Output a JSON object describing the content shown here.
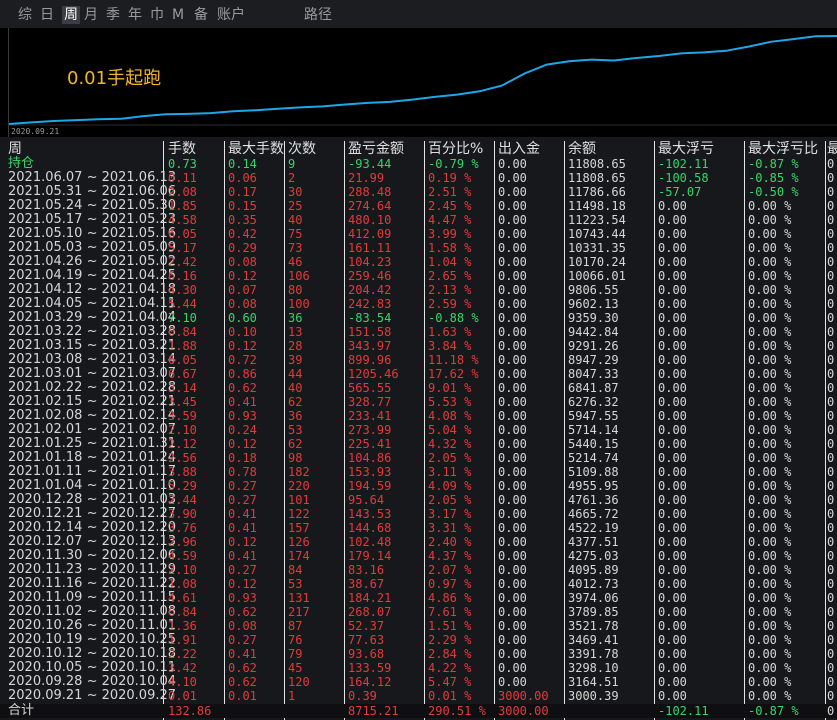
{
  "tabs": [
    {
      "label": "综",
      "state": "normal"
    },
    {
      "label": "日",
      "state": "normal"
    },
    {
      "label": "周",
      "state": "active"
    },
    {
      "label": "月",
      "state": "normal"
    },
    {
      "label": "季",
      "state": "normal"
    },
    {
      "label": "年",
      "state": "normal"
    },
    {
      "label": "巾",
      "state": "normal"
    },
    {
      "label": "M",
      "state": "normal"
    },
    {
      "label": "备",
      "state": "normal"
    },
    {
      "label": "账户",
      "state": "normal"
    },
    {
      "label": "路径",
      "state": "normal"
    }
  ],
  "chart": {
    "label": "0.01手起跑",
    "start_date": "2020.09.21",
    "line_color": "#1ea7e8",
    "label_color": "#f0b52a",
    "values": [
      3000.39,
      3164.51,
      3298.1,
      3391.78,
      3469.41,
      3521.78,
      3789.85,
      3974.06,
      4012.73,
      4095.89,
      4275.03,
      4377.51,
      4522.19,
      4665.72,
      4761.36,
      4955.95,
      5109.88,
      5214.74,
      5440.15,
      5714.14,
      5947.55,
      6276.32,
      6841.87,
      8047.33,
      8947.29,
      9291.26,
      9442.84,
      9359.3,
      9602.13,
      9806.55,
      10066.01,
      10170.24,
      10331.35,
      10743.44,
      11223.54,
      11498.18,
      11786.66,
      11808.65
    ]
  },
  "table": {
    "headers": [
      "周",
      "手数",
      "最大手数",
      "次数",
      "盈亏金额",
      "百分比%",
      "出入金",
      "余额",
      "最大浮亏",
      "最大浮亏比",
      "最"
    ],
    "holding": {
      "period": "持仓",
      "lots": "0.73",
      "max_lots": "0.14",
      "count": "9",
      "pnl": "-93.44",
      "pct": "-0.79 %",
      "io": "0.00",
      "balance": "11808.65",
      "max_float_loss": "-102.11",
      "max_float_loss_pct": "-0.87 %",
      "last": "0",
      "color": "green"
    },
    "rows": [
      {
        "period": "2021.06.07 ~ 2021.06.13",
        "lots": "0.11",
        "max_lots": "0.06",
        "count": "2",
        "pnl": "21.99",
        "pct": "0.19 %",
        "io": "0.00",
        "balance": "11808.65",
        "max_float_loss": "-100.58",
        "max_float_loss_pct": "-0.85 %",
        "last": "0",
        "color": "red",
        "float_color": "green"
      },
      {
        "period": "2021.05.31 ~ 2021.06.06",
        "lots": "2.08",
        "max_lots": "0.17",
        "count": "30",
        "pnl": "288.48",
        "pct": "2.51 %",
        "io": "0.00",
        "balance": "11786.66",
        "max_float_loss": "-57.07",
        "max_float_loss_pct": "-0.50 %",
        "last": "0",
        "color": "red",
        "float_color": "green"
      },
      {
        "period": "2021.05.24 ~ 2021.05.30",
        "lots": "1.85",
        "max_lots": "0.15",
        "count": "25",
        "pnl": "274.64",
        "pct": "2.45 %",
        "io": "0.00",
        "balance": "11498.18",
        "max_float_loss": "0.00",
        "max_float_loss_pct": "0.00 %",
        "last": "0",
        "color": "red",
        "float_color": "normal"
      },
      {
        "period": "2021.05.17 ~ 2021.05.23",
        "lots": "4.58",
        "max_lots": "0.35",
        "count": "40",
        "pnl": "480.10",
        "pct": "4.47 %",
        "io": "0.00",
        "balance": "11223.54",
        "max_float_loss": "0.00",
        "max_float_loss_pct": "0.00 %",
        "last": "0",
        "color": "red",
        "float_color": "normal"
      },
      {
        "period": "2021.05.10 ~ 2021.05.16",
        "lots": "6.05",
        "max_lots": "0.42",
        "count": "75",
        "pnl": "412.09",
        "pct": "3.99 %",
        "io": "0.00",
        "balance": "10743.44",
        "max_float_loss": "0.00",
        "max_float_loss_pct": "0.00 %",
        "last": "0",
        "color": "red",
        "float_color": "normal"
      },
      {
        "period": "2021.05.03 ~ 2021.05.09",
        "lots": "5.17",
        "max_lots": "0.29",
        "count": "73",
        "pnl": "161.11",
        "pct": "1.58 %",
        "io": "0.00",
        "balance": "10331.35",
        "max_float_loss": "0.00",
        "max_float_loss_pct": "0.00 %",
        "last": "0",
        "color": "red",
        "float_color": "normal"
      },
      {
        "period": "2021.04.26 ~ 2021.05.02",
        "lots": "2.42",
        "max_lots": "0.08",
        "count": "46",
        "pnl": "104.23",
        "pct": "1.04 %",
        "io": "0.00",
        "balance": "10170.24",
        "max_float_loss": "0.00",
        "max_float_loss_pct": "0.00 %",
        "last": "0",
        "color": "red",
        "float_color": "normal"
      },
      {
        "period": "2021.04.19 ~ 2021.04.25",
        "lots": "6.16",
        "max_lots": "0.12",
        "count": "106",
        "pnl": "259.46",
        "pct": "2.65 %",
        "io": "0.00",
        "balance": "10066.01",
        "max_float_loss": "0.00",
        "max_float_loss_pct": "0.00 %",
        "last": "0",
        "color": "red",
        "float_color": "normal"
      },
      {
        "period": "2021.04.12 ~ 2021.04.18",
        "lots": "4.30",
        "max_lots": "0.07",
        "count": "80",
        "pnl": "204.42",
        "pct": "2.13 %",
        "io": "0.00",
        "balance": "9806.55",
        "max_float_loss": "0.00",
        "max_float_loss_pct": "0.00 %",
        "last": "0",
        "color": "red",
        "float_color": "normal"
      },
      {
        "period": "2021.04.05 ~ 2021.04.11",
        "lots": "5.44",
        "max_lots": "0.08",
        "count": "100",
        "pnl": "242.83",
        "pct": "2.59 %",
        "io": "0.00",
        "balance": "9602.13",
        "max_float_loss": "0.00",
        "max_float_loss_pct": "0.00 %",
        "last": "0",
        "color": "red",
        "float_color": "normal"
      },
      {
        "period": "2021.03.29 ~ 2021.04.04",
        "lots": "7.10",
        "max_lots": "0.60",
        "count": "36",
        "pnl": "-83.54",
        "pct": "-0.88 %",
        "io": "0.00",
        "balance": "9359.30",
        "max_float_loss": "0.00",
        "max_float_loss_pct": "0.00 %",
        "last": "0",
        "color": "green",
        "float_color": "normal"
      },
      {
        "period": "2021.03.22 ~ 2021.03.28",
        "lots": "0.84",
        "max_lots": "0.10",
        "count": "13",
        "pnl": "151.58",
        "pct": "1.63 %",
        "io": "0.00",
        "balance": "9442.84",
        "max_float_loss": "0.00",
        "max_float_loss_pct": "0.00 %",
        "last": "0",
        "color": "red",
        "float_color": "normal"
      },
      {
        "period": "2021.03.15 ~ 2021.03.21",
        "lots": "1.88",
        "max_lots": "0.12",
        "count": "28",
        "pnl": "343.97",
        "pct": "3.84 %",
        "io": "0.00",
        "balance": "9291.26",
        "max_float_loss": "0.00",
        "max_float_loss_pct": "0.00 %",
        "last": "0",
        "color": "red",
        "float_color": "normal"
      },
      {
        "period": "2021.03.08 ~ 2021.03.14",
        "lots": "6.05",
        "max_lots": "0.72",
        "count": "39",
        "pnl": "899.96",
        "pct": "11.18 %",
        "io": "0.00",
        "balance": "8947.29",
        "max_float_loss": "0.00",
        "max_float_loss_pct": "0.00 %",
        "last": "0",
        "color": "red",
        "float_color": "normal"
      },
      {
        "period": "2021.03.01 ~ 2021.03.07",
        "lots": "6.67",
        "max_lots": "0.86",
        "count": "44",
        "pnl": "1205.46",
        "pct": "17.62 %",
        "io": "0.00",
        "balance": "8047.33",
        "max_float_loss": "0.00",
        "max_float_loss_pct": "0.00 %",
        "last": "0",
        "color": "red",
        "float_color": "normal"
      },
      {
        "period": "2021.02.22 ~ 2021.02.28",
        "lots": "3.14",
        "max_lots": "0.62",
        "count": "40",
        "pnl": "565.55",
        "pct": "9.01 %",
        "io": "0.00",
        "balance": "6841.87",
        "max_float_loss": "0.00",
        "max_float_loss_pct": "0.00 %",
        "last": "0",
        "color": "red",
        "float_color": "normal"
      },
      {
        "period": "2021.02.15 ~ 2021.02.21",
        "lots": "3.45",
        "max_lots": "0.41",
        "count": "62",
        "pnl": "328.77",
        "pct": "5.53 %",
        "io": "0.00",
        "balance": "6276.32",
        "max_float_loss": "0.00",
        "max_float_loss_pct": "0.00 %",
        "last": "0",
        "color": "red",
        "float_color": "normal"
      },
      {
        "period": "2021.02.08 ~ 2021.02.14",
        "lots": "3.59",
        "max_lots": "0.93",
        "count": "36",
        "pnl": "233.41",
        "pct": "4.08 %",
        "io": "0.00",
        "balance": "5947.55",
        "max_float_loss": "0.00",
        "max_float_loss_pct": "0.00 %",
        "last": "0",
        "color": "red",
        "float_color": "normal"
      },
      {
        "period": "2021.02.01 ~ 2021.02.07",
        "lots": "2.10",
        "max_lots": "0.24",
        "count": "53",
        "pnl": "273.99",
        "pct": "5.04 %",
        "io": "0.00",
        "balance": "5714.14",
        "max_float_loss": "0.00",
        "max_float_loss_pct": "0.00 %",
        "last": "0",
        "color": "red",
        "float_color": "normal"
      },
      {
        "period": "2021.01.25 ~ 2021.01.31",
        "lots": "2.12",
        "max_lots": "0.12",
        "count": "62",
        "pnl": "225.41",
        "pct": "4.32 %",
        "io": "0.00",
        "balance": "5440.15",
        "max_float_loss": "0.00",
        "max_float_loss_pct": "0.00 %",
        "last": "0",
        "color": "red",
        "float_color": "normal"
      },
      {
        "period": "2021.01.18 ~ 2021.01.24",
        "lots": "2.56",
        "max_lots": "0.18",
        "count": "98",
        "pnl": "104.86",
        "pct": "2.05 %",
        "io": "0.00",
        "balance": "5214.74",
        "max_float_loss": "0.00",
        "max_float_loss_pct": "0.00 %",
        "last": "0",
        "color": "red",
        "float_color": "normal"
      },
      {
        "period": "2021.01.11 ~ 2021.01.17",
        "lots": "3.88",
        "max_lots": "0.78",
        "count": "182",
        "pnl": "153.93",
        "pct": "3.11 %",
        "io": "0.00",
        "balance": "5109.88",
        "max_float_loss": "0.00",
        "max_float_loss_pct": "0.00 %",
        "last": "0",
        "color": "red",
        "float_color": "normal"
      },
      {
        "period": "2021.01.04 ~ 2021.01.10",
        "lots": "5.29",
        "max_lots": "0.27",
        "count": "220",
        "pnl": "194.59",
        "pct": "4.09 %",
        "io": "0.00",
        "balance": "4955.95",
        "max_float_loss": "0.00",
        "max_float_loss_pct": "0.00 %",
        "last": "0",
        "color": "red",
        "float_color": "normal"
      },
      {
        "period": "2020.12.28 ~ 2021.01.03",
        "lots": "2.44",
        "max_lots": "0.27",
        "count": "101",
        "pnl": "95.64",
        "pct": "2.05 %",
        "io": "0.00",
        "balance": "4761.36",
        "max_float_loss": "0.00",
        "max_float_loss_pct": "0.00 %",
        "last": "0",
        "color": "red",
        "float_color": "normal"
      },
      {
        "period": "2020.12.21 ~ 2020.12.27",
        "lots": "3.90",
        "max_lots": "0.41",
        "count": "122",
        "pnl": "143.53",
        "pct": "3.17 %",
        "io": "0.00",
        "balance": "4665.72",
        "max_float_loss": "0.00",
        "max_float_loss_pct": "0.00 %",
        "last": "0",
        "color": "red",
        "float_color": "normal"
      },
      {
        "period": "2020.12.14 ~ 2020.12.20",
        "lots": "3.76",
        "max_lots": "0.41",
        "count": "157",
        "pnl": "144.68",
        "pct": "3.31 %",
        "io": "0.00",
        "balance": "4522.19",
        "max_float_loss": "0.00",
        "max_float_loss_pct": "0.00 %",
        "last": "0",
        "color": "red",
        "float_color": "normal"
      },
      {
        "period": "2020.12.07 ~ 2020.12.13",
        "lots": "2.96",
        "max_lots": "0.12",
        "count": "126",
        "pnl": "102.48",
        "pct": "2.40 %",
        "io": "0.00",
        "balance": "4377.51",
        "max_float_loss": "0.00",
        "max_float_loss_pct": "0.00 %",
        "last": "0",
        "color": "red",
        "float_color": "normal"
      },
      {
        "period": "2020.11.30 ~ 2020.12.06",
        "lots": "4.59",
        "max_lots": "0.41",
        "count": "174",
        "pnl": "179.14",
        "pct": "4.37 %",
        "io": "0.00",
        "balance": "4275.03",
        "max_float_loss": "0.00",
        "max_float_loss_pct": "0.00 %",
        "last": "0",
        "color": "red",
        "float_color": "normal"
      },
      {
        "period": "2020.11.23 ~ 2020.11.29",
        "lots": "2.10",
        "max_lots": "0.27",
        "count": "84",
        "pnl": "83.16",
        "pct": "2.07 %",
        "io": "0.00",
        "balance": "4095.89",
        "max_float_loss": "0.00",
        "max_float_loss_pct": "0.00 %",
        "last": "0",
        "color": "red",
        "float_color": "normal"
      },
      {
        "period": "2020.11.16 ~ 2020.11.22",
        "lots": "1.08",
        "max_lots": "0.12",
        "count": "53",
        "pnl": "38.67",
        "pct": "0.97 %",
        "io": "0.00",
        "balance": "4012.73",
        "max_float_loss": "0.00",
        "max_float_loss_pct": "0.00 %",
        "last": "0",
        "color": "red",
        "float_color": "normal"
      },
      {
        "period": "2020.11.09 ~ 2020.11.15",
        "lots": "4.61",
        "max_lots": "0.93",
        "count": "131",
        "pnl": "184.21",
        "pct": "4.86 %",
        "io": "0.00",
        "balance": "3974.06",
        "max_float_loss": "0.00",
        "max_float_loss_pct": "0.00 %",
        "last": "0",
        "color": "red",
        "float_color": "normal"
      },
      {
        "period": "2020.11.02 ~ 2020.11.08",
        "lots": "6.84",
        "max_lots": "0.62",
        "count": "217",
        "pnl": "268.07",
        "pct": "7.61 %",
        "io": "0.00",
        "balance": "3789.85",
        "max_float_loss": "0.00",
        "max_float_loss_pct": "0.00 %",
        "last": "0",
        "color": "red",
        "float_color": "normal"
      },
      {
        "period": "2020.10.26 ~ 2020.11.01",
        "lots": "1.36",
        "max_lots": "0.08",
        "count": "87",
        "pnl": "52.37",
        "pct": "1.51 %",
        "io": "0.00",
        "balance": "3521.78",
        "max_float_loss": "0.00",
        "max_float_loss_pct": "0.00 %",
        "last": "0",
        "color": "red",
        "float_color": "normal"
      },
      {
        "period": "2020.10.19 ~ 2020.10.25",
        "lots": "1.91",
        "max_lots": "0.27",
        "count": "76",
        "pnl": "77.63",
        "pct": "2.29 %",
        "io": "0.00",
        "balance": "3469.41",
        "max_float_loss": "0.00",
        "max_float_loss_pct": "0.00 %",
        "last": "0",
        "color": "red",
        "float_color": "normal"
      },
      {
        "period": "2020.10.12 ~ 2020.10.18",
        "lots": "2.22",
        "max_lots": "0.41",
        "count": "79",
        "pnl": "93.68",
        "pct": "2.84 %",
        "io": "0.00",
        "balance": "3391.78",
        "max_float_loss": "0.00",
        "max_float_loss_pct": "0.00 %",
        "last": "0",
        "color": "red",
        "float_color": "normal"
      },
      {
        "period": "2020.10.05 ~ 2020.10.11",
        "lots": "3.42",
        "max_lots": "0.62",
        "count": "45",
        "pnl": "133.59",
        "pct": "4.22 %",
        "io": "0.00",
        "balance": "3298.10",
        "max_float_loss": "0.00",
        "max_float_loss_pct": "0.00 %",
        "last": "0",
        "color": "red",
        "float_color": "normal"
      },
      {
        "period": "2020.09.28 ~ 2020.10.04",
        "lots": "4.10",
        "max_lots": "0.62",
        "count": "120",
        "pnl": "164.12",
        "pct": "5.47 %",
        "io": "0.00",
        "balance": "3164.51",
        "max_float_loss": "0.00",
        "max_float_loss_pct": "0.00 %",
        "last": "0",
        "color": "red",
        "float_color": "normal"
      },
      {
        "period": "2020.09.21 ~ 2020.09.27",
        "lots": "0.01",
        "max_lots": "0.01",
        "count": "1",
        "pnl": "0.39",
        "pct": "0.01 %",
        "io": "3000.00",
        "balance": "3000.39",
        "max_float_loss": "0.00",
        "max_float_loss_pct": "0.00 %",
        "last": "0",
        "color": "red",
        "float_color": "normal"
      }
    ],
    "total": {
      "period": "合计",
      "lots": "132.86",
      "max_lots": "",
      "count": "",
      "pnl": "8715.21",
      "pct": "290.51 %",
      "io": "3000.00",
      "balance": "",
      "max_float_loss": "-102.11",
      "max_float_loss_pct": "-0.87 %",
      "last": "0"
    }
  }
}
